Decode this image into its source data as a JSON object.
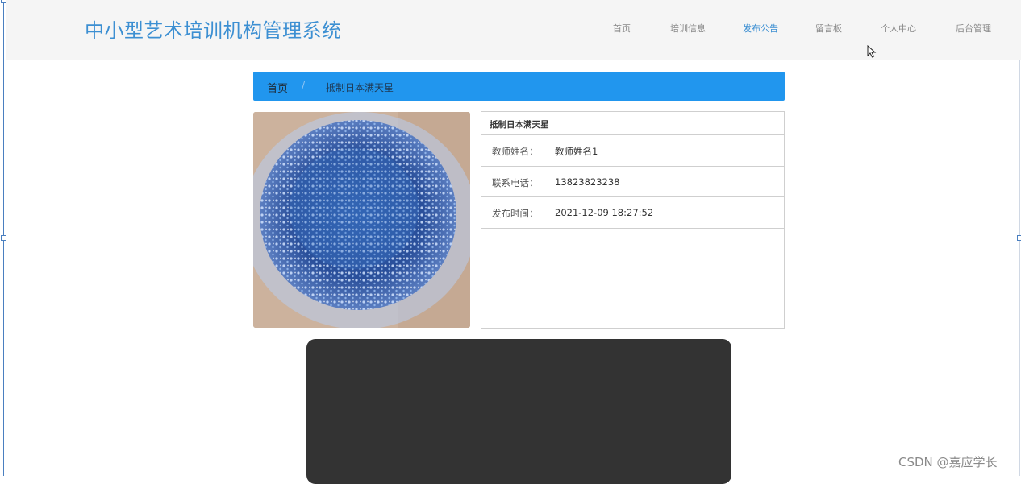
{
  "header": {
    "site_title": "中小型艺术培训机构管理系统",
    "nav": [
      {
        "label": "首页",
        "active": false
      },
      {
        "label": "培训信息",
        "active": false
      },
      {
        "label": "发布公告",
        "active": true
      },
      {
        "label": "留言板",
        "active": false
      },
      {
        "label": "个人中心",
        "active": false
      },
      {
        "label": "后台管理",
        "active": false
      }
    ]
  },
  "breadcrumb": {
    "home": "首页",
    "separator": "/",
    "current": "抵制日本满天星"
  },
  "detail": {
    "title": "抵制日本满天星",
    "rows": [
      {
        "label": "教师姓名：",
        "value": "教师姓名1"
      },
      {
        "label": "联系电话：",
        "value": "13823823238"
      },
      {
        "label": "发布时间：",
        "value": "2021-12-09 18:27:52"
      }
    ]
  },
  "watermark": "CSDN @嘉应学长",
  "colors": {
    "accent": "#3c8fd2",
    "breadcrumb_bg": "#2196ee",
    "dark_box": "#333333"
  }
}
